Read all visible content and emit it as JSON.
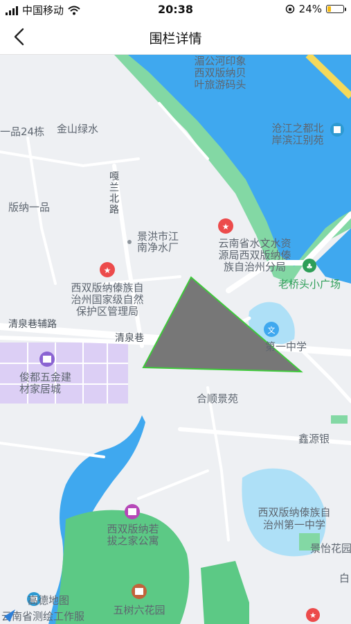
{
  "status_bar": {
    "carrier": "中国移动",
    "time": "20:38",
    "battery": "24%",
    "battery_level": 0.24
  },
  "nav": {
    "title": "围栏详情"
  },
  "map": {
    "labels": {
      "river_pier": [
        "湄公河印象",
        "西双版纳贝",
        "叶旅游码头"
      ],
      "pin_24": "一品24栋",
      "jinshan": "金山绿水",
      "garan_road": [
        "嘎",
        "兰",
        "北",
        "路"
      ],
      "cangjiang": [
        "沧江之都北",
        "岸滨江别苑"
      ],
      "banna_yipin": "版纳一品",
      "water_plant": [
        "景洪市江",
        "南净水厂"
      ],
      "hydrology": [
        "云南省水文水资",
        "源局西双版纳傣",
        "族自治州分局"
      ],
      "laoqiao": "老桥头小广场",
      "reserve": [
        "西双版纳傣族自",
        "治州国家级自然",
        "保护区管理局"
      ],
      "qingquan_aux": "清泉巷辅路",
      "qingquan": "清泉巷",
      "school1": "第一中学",
      "junction": "俊都五金建",
      "junction2": "材家居城",
      "heshun": "合顺景苑",
      "xinyuan": "鑫源银",
      "school_big": [
        "西双版纳傣族自",
        "治州第一中学"
      ],
      "jingyi": "景怡花园",
      "apartment": [
        "西双版纳若",
        "拔之家公寓"
      ],
      "park": "五树六花园",
      "gaode": "高德地图",
      "bottom_left": "云南省测绘工作服",
      "bai": "白"
    },
    "colors": {
      "water": "#3fa8ef",
      "green": "#7ed9a0",
      "park_green": "#5cc985",
      "fence_fill": "#777777",
      "fence_stroke": "#3ec93a"
    }
  }
}
